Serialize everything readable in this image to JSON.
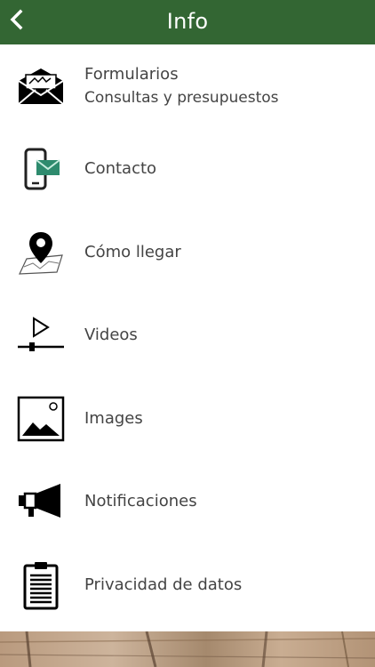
{
  "header": {
    "title": "Info",
    "back_icon": "chevron-left-icon",
    "background": "#336633"
  },
  "menu": {
    "items": [
      {
        "label": "Formularios",
        "sublabel": "Consultas y presupuestos",
        "icon": "envelope-icon"
      },
      {
        "label": "Contacto",
        "icon": "phone-message-icon"
      },
      {
        "label": "Cómo llegar",
        "icon": "map-pin-icon"
      },
      {
        "label": "Videos",
        "icon": "video-player-icon"
      },
      {
        "label": "Images",
        "icon": "image-icon"
      },
      {
        "label": "Notificaciones",
        "icon": "megaphone-icon"
      },
      {
        "label": "Privacidad de datos",
        "icon": "clipboard-icon"
      }
    ],
    "accent": "#2e8b6e"
  },
  "footer": {
    "image": "wood-photo-strip"
  }
}
